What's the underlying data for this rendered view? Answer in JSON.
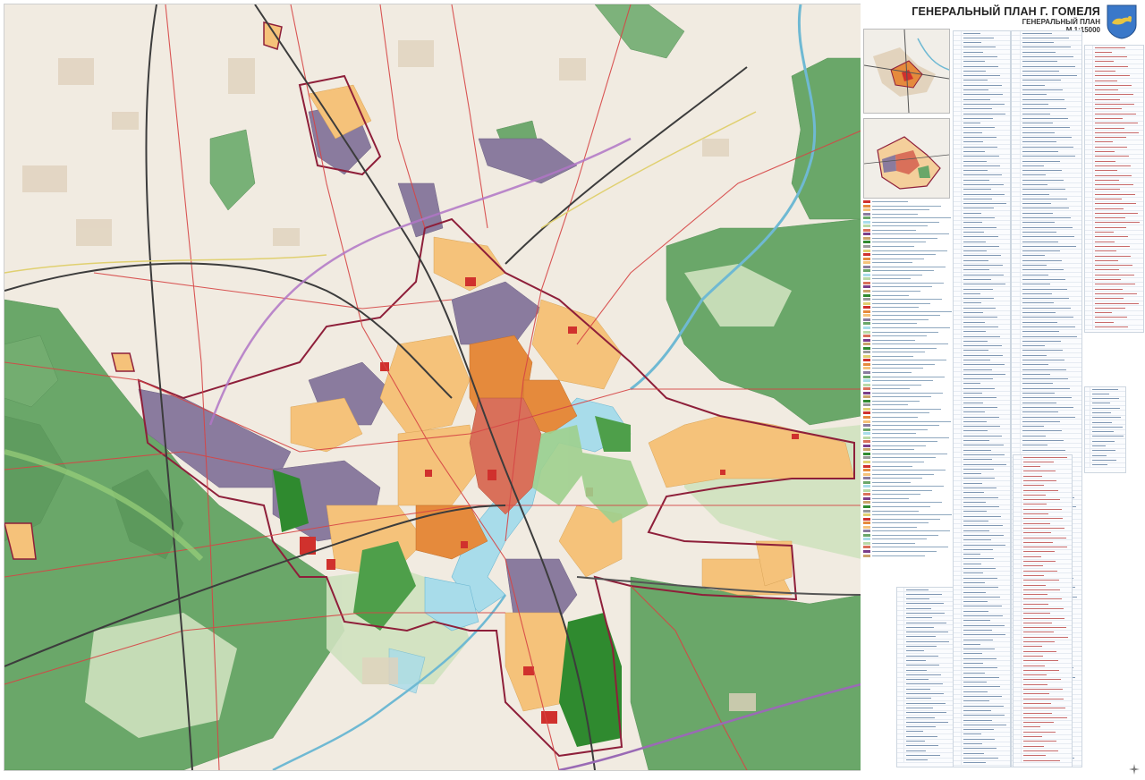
{
  "header": {
    "title": "ГЕНЕРАЛЬНЫЙ ПЛАН Г. ГОМЕЛЯ",
    "subtitle": "ГЕНЕРАЛЬНЫЙ ПЛАН",
    "scale": "М 1:15000"
  },
  "icons": {
    "emblem": "gomel-coat-of-arms-icon",
    "footer": "compass-logo-icon"
  },
  "colors": {
    "residential": "#f5c27a",
    "residential_dense": "#e58a3c",
    "center": "#d9705a",
    "industrial": "#8a7b9e",
    "public": "#d0312d",
    "forest": "#6aa769",
    "forest_dark": "#2f8a2f",
    "water": "#a8dcea",
    "greenery": "#b9d9a7",
    "rural": "#efe6d9",
    "arable": "#e7dfcf",
    "roads": "#d64545",
    "railway": "#3c3c3c",
    "boundary": "#8e1f3a"
  },
  "legend_colors": [
    "#d0312d",
    "#e58a3c",
    "#f5c27a",
    "#8a7b9e",
    "#6aa769",
    "#a8dcea",
    "#b9d9a7",
    "#d9705a",
    "#7a3d8a",
    "#c9a36a",
    "#2f8a2f",
    "#999999",
    "#e0d070"
  ]
}
